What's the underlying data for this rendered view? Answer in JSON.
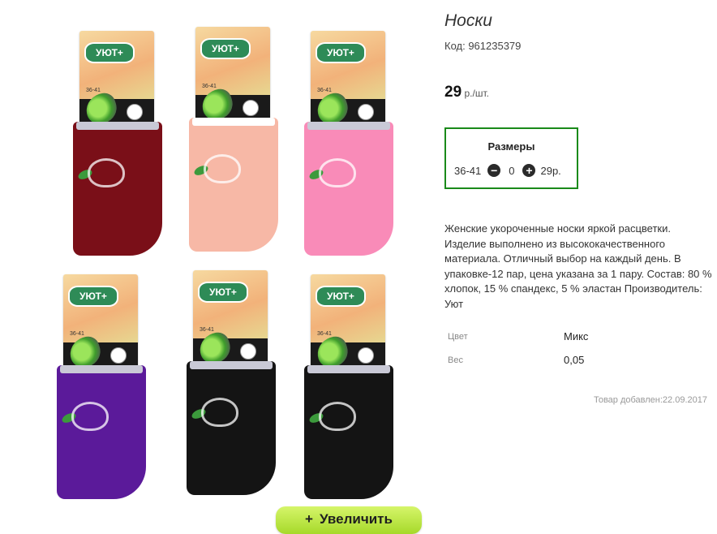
{
  "product": {
    "title": "Носки",
    "code": "Код: 961235379",
    "price_value": "29",
    "price_unit": " р./шт.",
    "description": "Женские укороченные носки яркой расцветки. Изделие выполнено из высококачественного материала. Отличный выбор на каждый день. В упаковке-12 пар, цена указана за 1 пару. Состав: 80 % хлопок, 15 % спандекс, 5 % эластан Производитель: Уют",
    "added": "Товар добавлен:22.09.2017"
  },
  "sizes": {
    "heading": "Размеры",
    "rows": [
      {
        "size": "36-41",
        "qty": "0",
        "price": "29р."
      }
    ],
    "minus_icon": "minus-circle-icon",
    "plus_icon": "plus-circle-icon",
    "border_color": "#1a8a1a"
  },
  "properties": [
    {
      "key": "Цвет",
      "value": "Микс"
    },
    {
      "key": "Вес",
      "value": "0,05"
    }
  ],
  "gallery": {
    "brand": "УЮТ+",
    "size_text": "36-41",
    "sock_colors": [
      "#7a0f18",
      "#f7b8a6",
      "#f98bb8",
      "#5b1a9a",
      "#141414",
      "#141414"
    ],
    "zoom_button": {
      "icon": "+",
      "label": "Увеличить"
    }
  }
}
